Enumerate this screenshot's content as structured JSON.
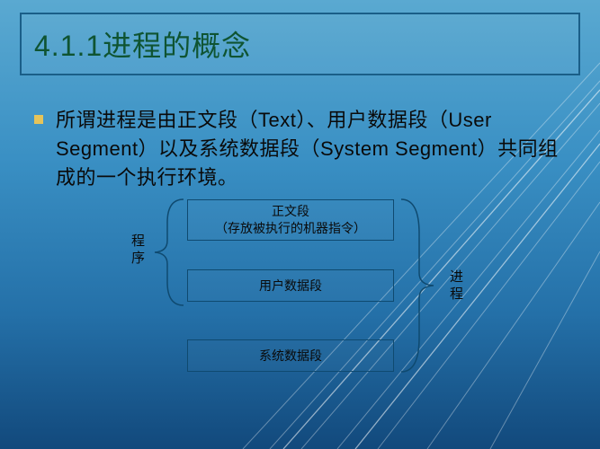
{
  "title": "4.1.1进程的概念",
  "paragraph": "所谓进程是由正文段（Text）、用户数据段（User Segment）以及系统数据段（System Segment）共同组成的一个执行环境。",
  "diagram": {
    "left_label": "程序",
    "right_label": "进程",
    "seg1_line1": "正文段",
    "seg1_line2": "（存放被执行的机器指令）",
    "seg2": "用户数据段",
    "seg3": "系统数据段"
  }
}
